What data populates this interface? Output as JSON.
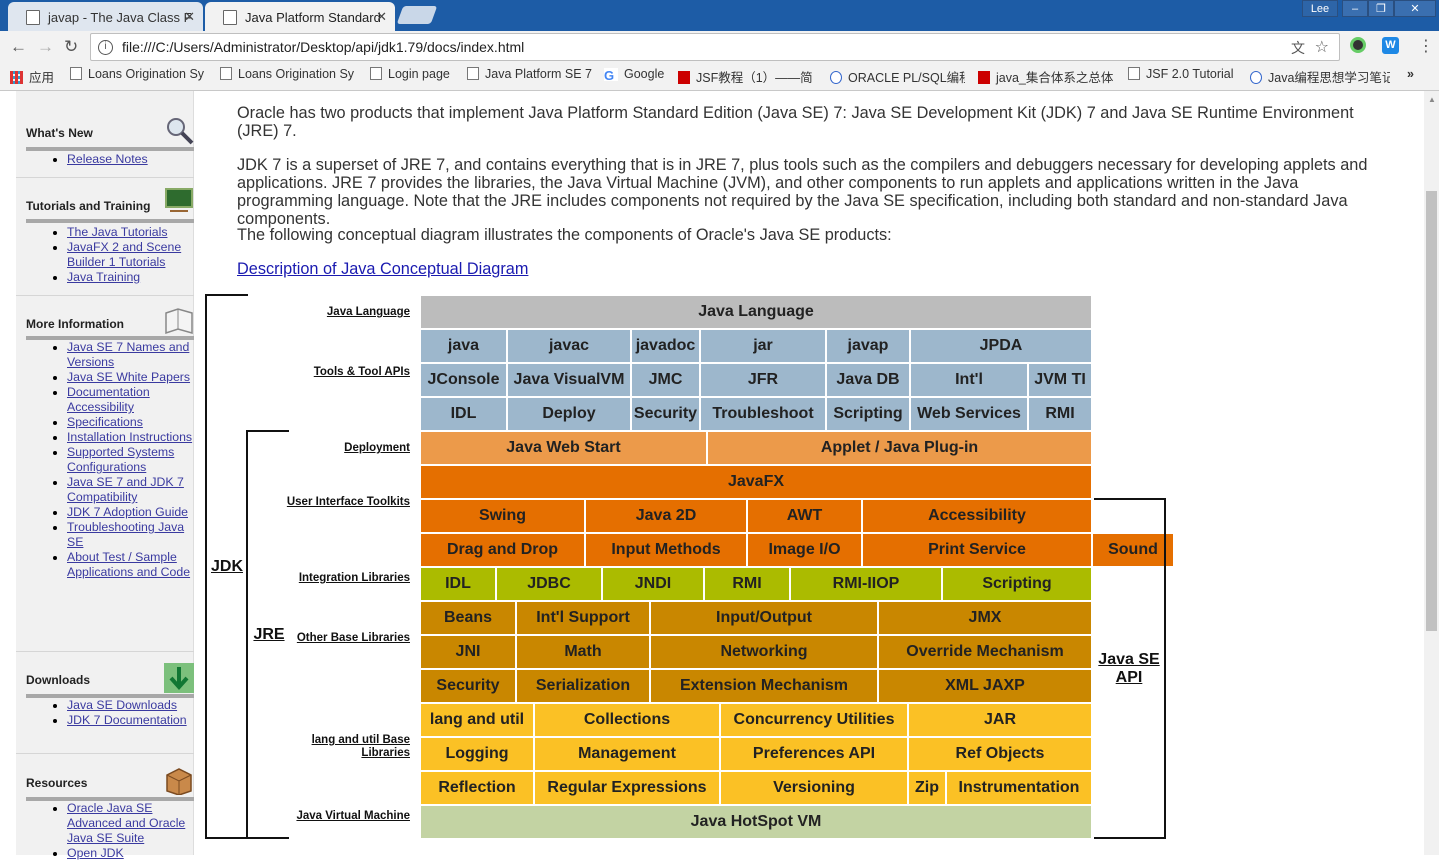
{
  "tabs": [
    {
      "label": "javap - The Java Class F"
    },
    {
      "label": "Java Platform Standard"
    }
  ],
  "window": {
    "user": "Lee",
    "minimize": "–",
    "restore": "❐",
    "close": "✕"
  },
  "address": {
    "url": "file:///C:/Users/Administrator/Desktop/api/jdk1.79/docs/index.html"
  },
  "bookmarks": [
    {
      "label": "应用"
    },
    {
      "label": "Loans Origination Sy"
    },
    {
      "label": "Loans Origination Sy"
    },
    {
      "label": "Login page"
    },
    {
      "label": "Java Platform SE 7"
    },
    {
      "label": "Google"
    },
    {
      "label": "JSF教程（1）——简"
    },
    {
      "label": "ORACLE PL/SQL编程"
    },
    {
      "label": "java_集合体系之总体"
    },
    {
      "label": "JSF 2.0 Tutorial"
    },
    {
      "label": "Java编程思想学习笔记"
    }
  ],
  "bookmarks_more": "»",
  "sidebar": {
    "sections": [
      {
        "title": "What's New",
        "links": [
          "Release Notes"
        ]
      },
      {
        "title": "Tutorials and Training",
        "links": [
          "The Java Tutorials",
          "JavaFX 2 and Scene Builder 1 Tutorials",
          "Java Training"
        ]
      },
      {
        "title": "More Information",
        "links": [
          "Java SE 7 Names and Versions",
          "Java SE White Papers",
          "Documentation Accessibility",
          "Specifications",
          "Installation Instructions",
          "Supported Systems Configurations",
          "Java SE 7 and JDK 7 Compatibility",
          "JDK 7 Adoption Guide",
          "Troubleshooting Java SE",
          "About Test / Sample Applications and Code"
        ]
      },
      {
        "title": "Downloads",
        "links": [
          "Java SE Downloads",
          "JDK 7 Documentation"
        ]
      },
      {
        "title": "Resources",
        "links": [
          "Oracle Java SE Advanced and Oracle Java SE Suite",
          "Open JDK"
        ]
      }
    ]
  },
  "main": {
    "p1": "Oracle has two products that implement Java Platform Standard Edition (Java SE) 7: Java SE Development Kit (JDK) 7 and Java SE Runtime Environment (JRE) 7.",
    "p2": "JDK 7 is a superset of JRE 7, and contains everything that is in JRE 7, plus tools such as the compilers and debuggers necessary for developing applets and applications. JRE 7 provides the libraries, the Java Virtual Machine (JVM), and other components to run applets and applications written in the Java programming language. Note that the JRE includes components not required by the Java SE specification, including both standard and non-standard Java components.",
    "p3": "The following conceptual diagram illustrates the components of Oracle's Java SE products:",
    "link": "Description of Java Conceptual Diagram"
  },
  "diagram": {
    "colors": {
      "language": "#bcbcbc",
      "tools": "#9db7cc",
      "deploy": "#ec9a4a",
      "ui": "#e56f00",
      "integration": "#abbb00",
      "base": "#c98700",
      "lang": "#fbc125",
      "vm": "#c3d3a3"
    },
    "row_labels": [
      {
        "text": "Java Language"
      },
      {
        "text": "Tools & Tool APIs"
      },
      {
        "text": "Deployment"
      },
      {
        "text": "User Interface Toolkits"
      },
      {
        "text": "Integration Libraries"
      },
      {
        "text": "Other Base Libraries"
      },
      {
        "text": "lang and util Base Libraries"
      },
      {
        "text": "Java Virtual Machine"
      }
    ],
    "rows": [
      {
        "color": "language",
        "cells": [
          "Java Language"
        ]
      },
      {
        "color": "tools",
        "cells": [
          "java",
          "javac",
          "javadoc",
          "jar",
          "javap",
          "JPDA"
        ]
      },
      {
        "color": "tools",
        "cells": [
          "JConsole",
          "Java VisualVM",
          "JMC",
          "JFR",
          "Java DB",
          "Int'l",
          "JVM TI"
        ]
      },
      {
        "color": "tools",
        "cells": [
          "IDL",
          "Deploy",
          "Security",
          "Troubleshoot",
          "Scripting",
          "Web Services",
          "RMI"
        ]
      },
      {
        "color": "deploy",
        "cells": [
          "Java Web Start",
          "Applet / Java Plug-in"
        ]
      },
      {
        "color": "ui",
        "cells": [
          "JavaFX"
        ]
      },
      {
        "color": "ui",
        "cells": [
          "Swing",
          "Java 2D",
          "AWT",
          "Accessibility"
        ]
      },
      {
        "color": "ui",
        "cells": [
          "Drag and Drop",
          "Input Methods",
          "Image I/O",
          "Print Service",
          "Sound"
        ]
      },
      {
        "color": "integration",
        "cells": [
          "IDL",
          "JDBC",
          "JNDI",
          "RMI",
          "RMI-IIOP",
          "Scripting"
        ]
      },
      {
        "color": "base",
        "cells": [
          "Beans",
          "Int'l Support",
          "Input/Output",
          "JMX"
        ]
      },
      {
        "color": "base",
        "cells": [
          "JNI",
          "Math",
          "Networking",
          "Override Mechanism"
        ]
      },
      {
        "color": "base",
        "cells": [
          "Security",
          "Serialization",
          "Extension Mechanism",
          "XML JAXP"
        ]
      },
      {
        "color": "lang",
        "cells": [
          "lang and util",
          "Collections",
          "Concurrency Utilities",
          "JAR"
        ]
      },
      {
        "color": "lang",
        "cells": [
          "Logging",
          "Management",
          "Preferences API",
          "Ref Objects"
        ]
      },
      {
        "color": "lang",
        "cells": [
          "Reflection",
          "Regular Expressions",
          "Versioning",
          "Zip",
          "Instrumentation"
        ]
      },
      {
        "color": "vm",
        "cells": [
          "Java HotSpot VM"
        ]
      }
    ],
    "jdk": "JDK",
    "jre": "JRE",
    "api": "Java SE API"
  }
}
